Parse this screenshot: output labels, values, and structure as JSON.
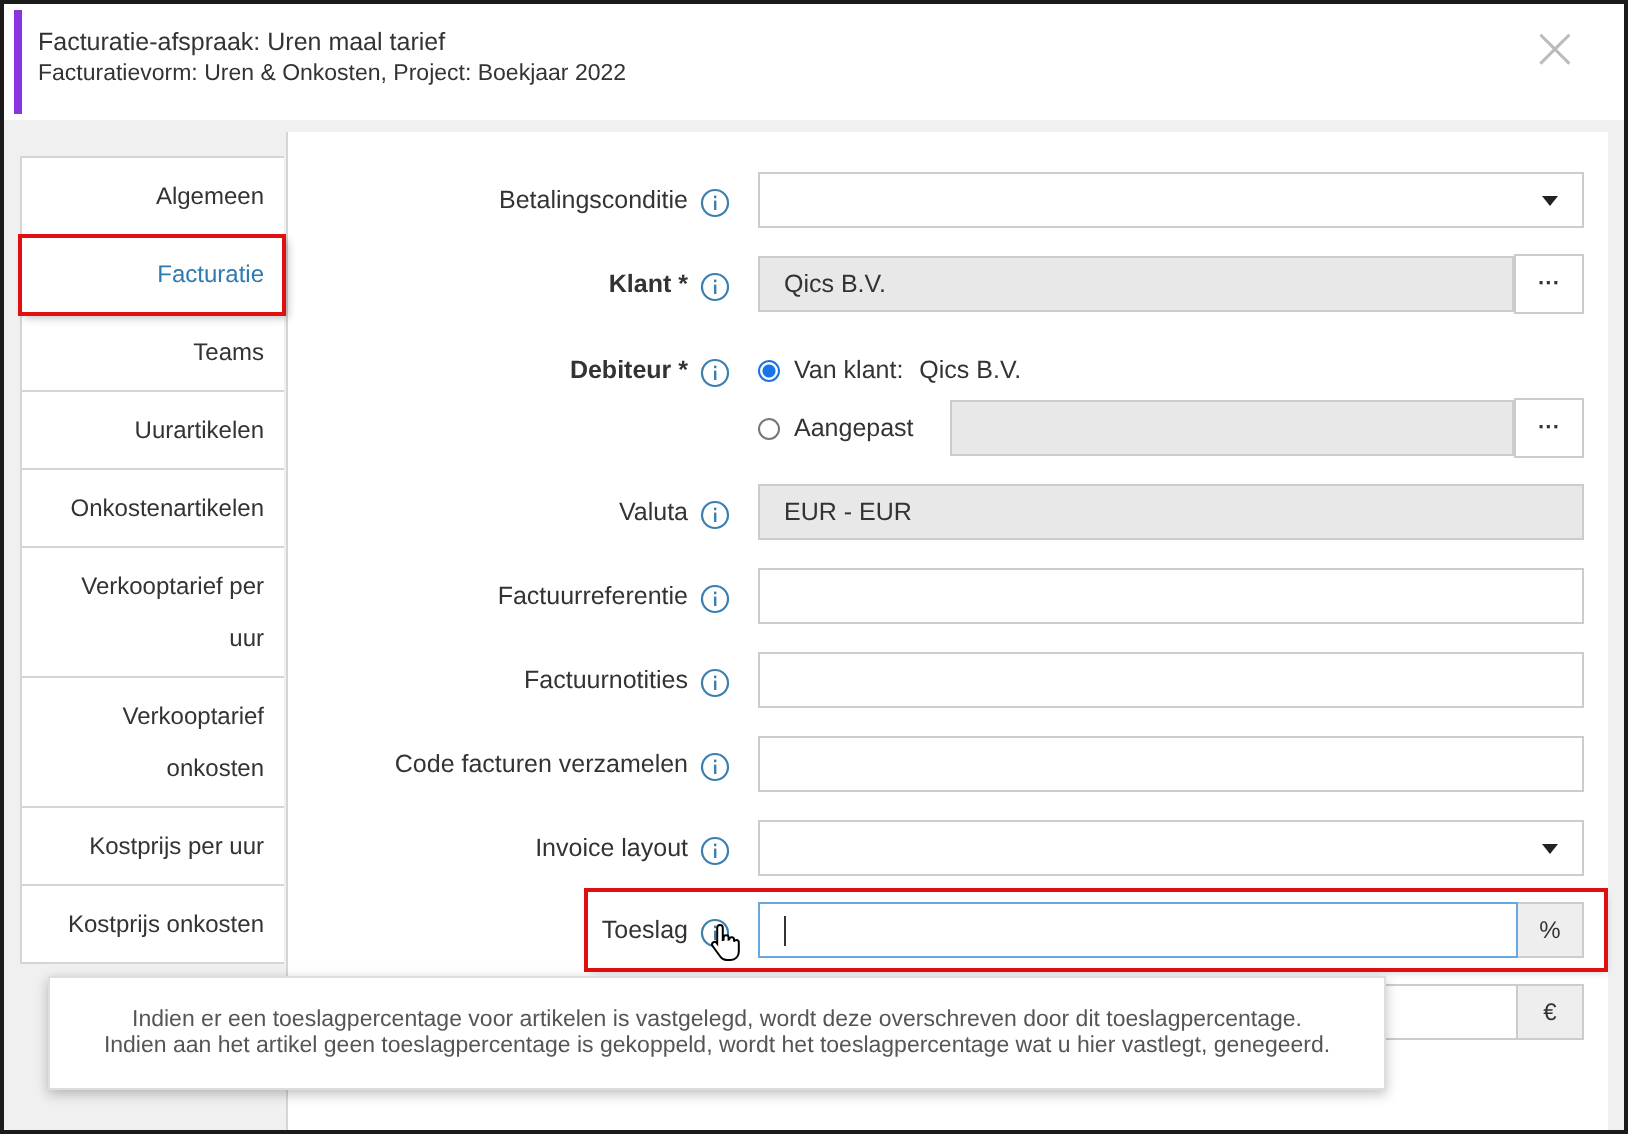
{
  "window": {
    "title": "Facturatie-afspraak: Uren maal tarief",
    "subtitle": "Facturatievorm: Uren & Onkosten, Project: Boekjaar 2022",
    "close": "×"
  },
  "tabs": [
    {
      "label": "Algemeen",
      "selected": false
    },
    {
      "label": "Facturatie",
      "selected": true
    },
    {
      "label": "Teams",
      "selected": false
    },
    {
      "label": "Uurartikelen",
      "selected": false
    },
    {
      "label": "Onkostenartikelen",
      "selected": false
    },
    {
      "label": "Verkooptarief per uur",
      "selected": false
    },
    {
      "label": "Verkooptarief onkosten",
      "selected": false
    },
    {
      "label": "Kostprijs per uur",
      "selected": false
    },
    {
      "label": "Kostprijs onkosten",
      "selected": false
    }
  ],
  "fields": [
    {
      "kind": "select",
      "label": "Betalingsconditie",
      "required": false
    },
    {
      "kind": "lookup",
      "label": "Klant *",
      "required": true,
      "value": "Qics B.V.",
      "button": "···"
    },
    {
      "kind": "radio",
      "label": "Debiteur *",
      "required": true,
      "options": [
        {
          "label": "Van klant:",
          "value": "Qics B.V.",
          "selected": true
        },
        {
          "label": "Aangepast",
          "selected": false,
          "button": "···"
        }
      ]
    },
    {
      "kind": "readonly",
      "label": "Valuta",
      "required": false,
      "value": "EUR - EUR"
    },
    {
      "kind": "text",
      "label": "Factuurreferentie",
      "required": false
    },
    {
      "kind": "text",
      "label": "Factuurnotities",
      "required": false
    },
    {
      "kind": "text",
      "label": "Code facturen verzamelen",
      "required": false
    },
    {
      "kind": "select",
      "label": "Invoice layout",
      "required": false
    },
    {
      "kind": "suffix",
      "label": "Toeslag",
      "required": false,
      "suffix": "%",
      "focused": true,
      "highlighted": true
    },
    {
      "kind": "suffix",
      "suffix": "€",
      "focused": false,
      "highlighted": false
    }
  ],
  "tooltip": {
    "lines": [
      "Indien er een toeslagpercentage voor artikelen is vastgelegd, wordt deze overschreven door dit toeslagpercentage.",
      "Indien aan het artikel geen toeslagpercentage is gekoppeld, wordt het toeslagpercentage wat u hier vastlegt, genegeerd."
    ]
  }
}
